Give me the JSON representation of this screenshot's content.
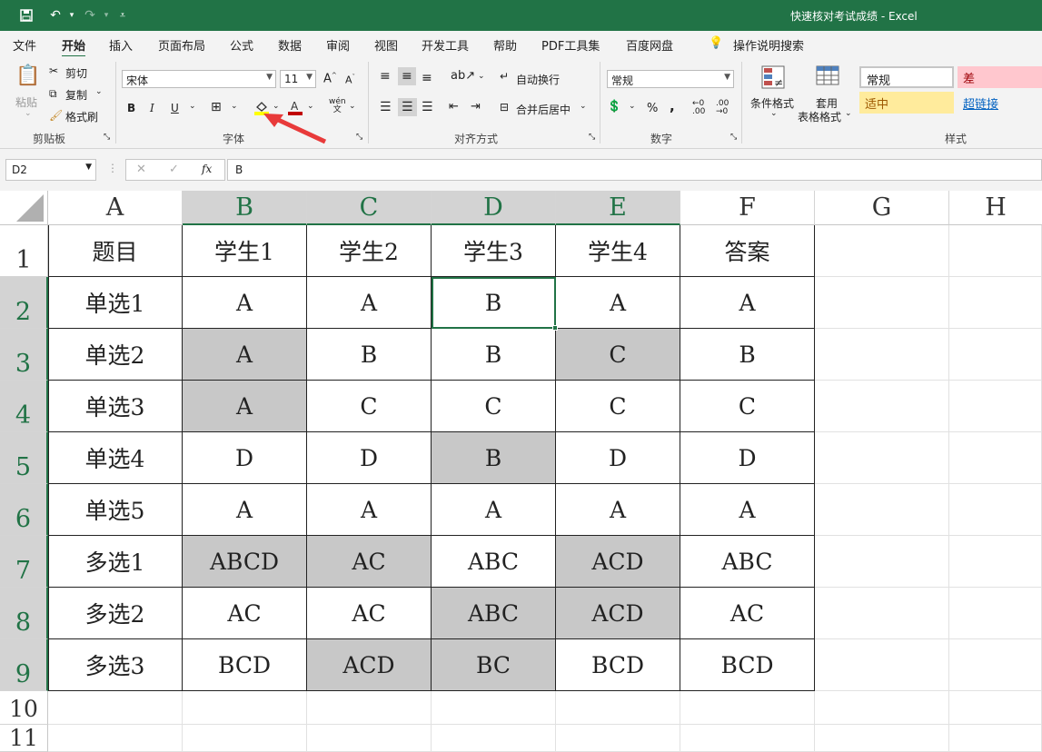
{
  "window": {
    "title": "快速核对考试成绩 - Excel"
  },
  "quick_access": {
    "save_icon": "save-icon",
    "undo_icon": "undo-icon",
    "redo_icon": "redo-icon",
    "customize_icon": "customize-icon"
  },
  "menu_tabs": [
    "文件",
    "开始",
    "插入",
    "页面布局",
    "公式",
    "数据",
    "审阅",
    "视图",
    "开发工具",
    "帮助",
    "PDF工具集",
    "百度网盘",
    "操作说明搜索"
  ],
  "active_tab": "开始",
  "ribbon": {
    "clipboard": {
      "paste": "粘贴",
      "cut": "剪切",
      "copy": "复制",
      "format_painter": "格式刷",
      "group": "剪贴板"
    },
    "font": {
      "name": "宋体",
      "size": "11",
      "bold": "B",
      "italic": "I",
      "underline": "U",
      "group": "字体",
      "font_color": "#c00000",
      "fill_color": "#ffff00"
    },
    "alignment": {
      "wrap": "自动换行",
      "merge": "合并后居中",
      "group": "对齐方式"
    },
    "number": {
      "format": "常规",
      "percent": "%",
      "comma": ",",
      "group": "数字"
    },
    "styles": {
      "conditional": "条件格式",
      "table1": "套用",
      "table2": "表格格式",
      "normal": "常规",
      "bad": "差",
      "neutral": "适中",
      "hyperlink": "超链接",
      "group": "样式"
    }
  },
  "formula_bar": {
    "name_box": "D2",
    "formula": "B",
    "cancel": "✕",
    "enter": "✓",
    "fx": "fx"
  },
  "columns": [
    "A",
    "B",
    "C",
    "D",
    "E",
    "F",
    "G",
    "H"
  ],
  "rows": [
    "1",
    "2",
    "3",
    "4",
    "5",
    "6",
    "7",
    "8",
    "9",
    "10",
    "11"
  ],
  "table": {
    "header": [
      "题目",
      "学生1",
      "学生2",
      "学生3",
      "学生4",
      "答案"
    ],
    "rows": [
      {
        "cells": [
          "单选1",
          "A",
          "A",
          "B",
          "A",
          "A"
        ],
        "gray": []
      },
      {
        "cells": [
          "单选2",
          "A",
          "B",
          "B",
          "C",
          "B"
        ],
        "gray": [
          1,
          4
        ]
      },
      {
        "cells": [
          "单选3",
          "A",
          "C",
          "C",
          "C",
          "C"
        ],
        "gray": [
          1
        ]
      },
      {
        "cells": [
          "单选4",
          "D",
          "D",
          "B",
          "D",
          "D"
        ],
        "gray": [
          3
        ]
      },
      {
        "cells": [
          "单选5",
          "A",
          "A",
          "A",
          "A",
          "A"
        ],
        "gray": []
      },
      {
        "cells": [
          "多选1",
          "ABCD",
          "AC",
          "ABC",
          "ACD",
          "ABC"
        ],
        "gray": [
          1,
          2,
          4
        ]
      },
      {
        "cells": [
          "多选2",
          "AC",
          "AC",
          "ABC",
          "ACD",
          "AC"
        ],
        "gray": [
          3,
          4
        ]
      },
      {
        "cells": [
          "多选3",
          "BCD",
          "ACD",
          "BC",
          "BCD",
          "BCD"
        ],
        "gray": [
          2,
          3
        ]
      }
    ]
  },
  "colors": {
    "accent": "#217346",
    "gray_fill": "#c8c8c8",
    "arrow": "#e83a3a"
  }
}
